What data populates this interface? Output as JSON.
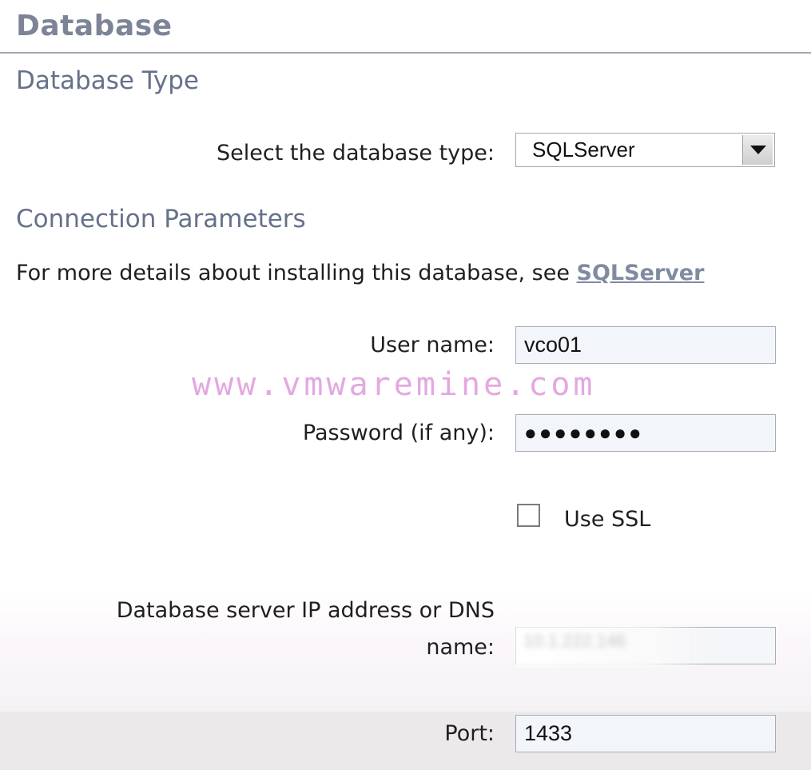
{
  "page": {
    "title": "Database"
  },
  "database_type": {
    "heading": "Database Type",
    "select_label": "Select the database type:",
    "selected_value": "SQLServer"
  },
  "connection": {
    "heading": "Connection Parameters",
    "info_prefix": "For more details about installing this database, see ",
    "info_link": "SQLServer",
    "fields": {
      "user_name_label": "User name:",
      "user_name_value": "vco01",
      "password_label": "Password (if any):",
      "password_value": "●●●●●●●●",
      "use_ssl_label": "Use SSL",
      "use_ssl_checked": false,
      "server_label": "Database server IP address or DNS name:",
      "server_value": "10.1.222.146",
      "port_label": "Port:",
      "port_value": "1433"
    }
  },
  "watermark": "www.vmwaremine.com",
  "colors": {
    "title": "#7d8497",
    "heading": "#66718a",
    "link": "#808aa0",
    "field_bg": "#f2f6fb",
    "watermark": "#e4a8e0"
  }
}
